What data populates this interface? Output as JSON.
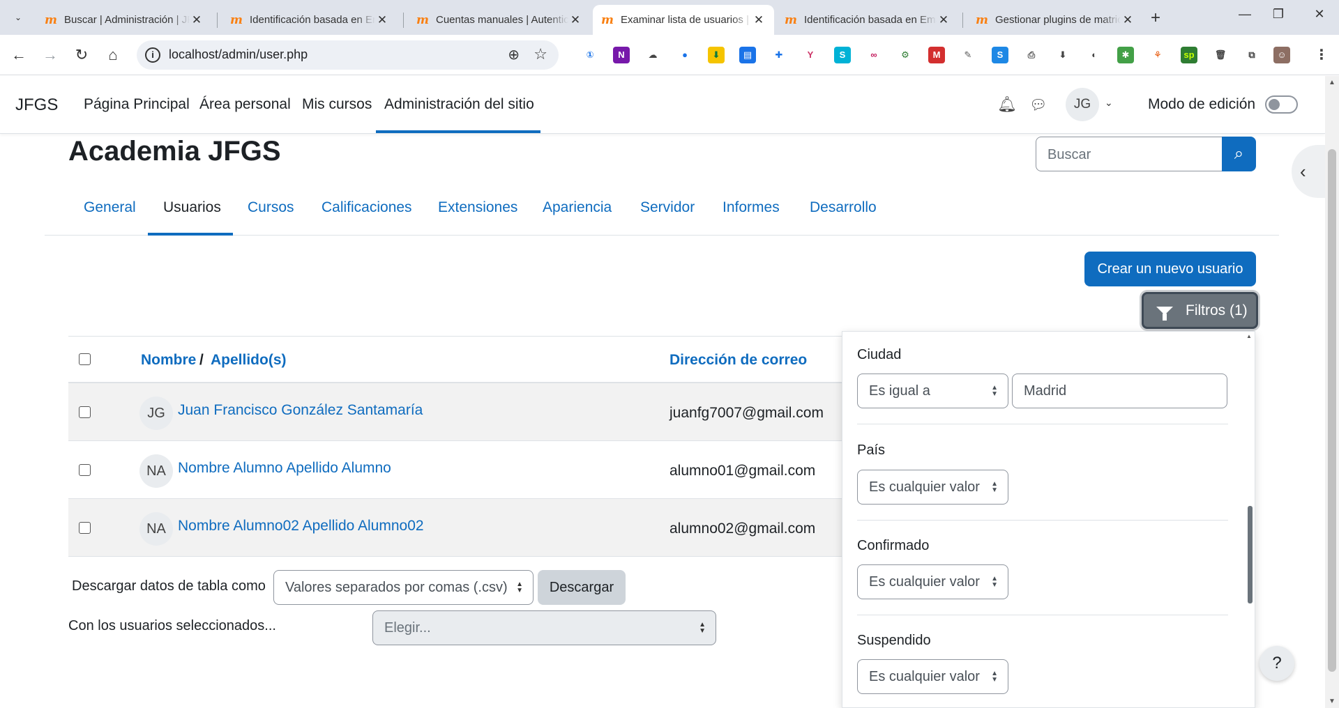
{
  "browser": {
    "tabs": [
      {
        "title": "Buscar | Administración | JFGS",
        "active": false
      },
      {
        "title": "Identificación basada en Email",
        "active": false
      },
      {
        "title": "Cuentas manuales | Autenticación",
        "active": false
      },
      {
        "title": "Examinar lista de usuarios | Academia JFGS",
        "active": true
      },
      {
        "title": "Identificación basada en Email",
        "active": false
      },
      {
        "title": "Gestionar plugins de matriculación",
        "active": false
      }
    ],
    "tab_close": "✕",
    "new_tab": "+",
    "url": "localhost/admin/user.php",
    "extensions": [
      {
        "name": "password-manager-icon",
        "glyph": "①",
        "color": "#ffffff",
        "fg": "#1a73e8"
      },
      {
        "name": "onenote-icon",
        "glyph": "N",
        "color": "#7719aa",
        "fg": "#ffffff"
      },
      {
        "name": "cloud-icon",
        "glyph": "☁",
        "color": "#ffffff",
        "fg": "#444444"
      },
      {
        "name": "blue-dot-icon",
        "glyph": "●",
        "color": "#ffffff",
        "fg": "#1a73e8"
      },
      {
        "name": "download-green-icon",
        "glyph": "⬇",
        "color": "#f5c400",
        "fg": "#0b7a3e"
      },
      {
        "name": "save-icon",
        "glyph": "▤",
        "color": "#1a73e8",
        "fg": "#ffffff"
      },
      {
        "name": "doc-plus-icon",
        "glyph": "✚",
        "color": "#ffffff",
        "fg": "#1a73e8"
      },
      {
        "name": "leaf-icon",
        "glyph": "Y",
        "color": "#ffffff",
        "fg": "#cc3366"
      },
      {
        "name": "s-icon",
        "glyph": "S",
        "color": "#00b2d6",
        "fg": "#ffffff"
      },
      {
        "name": "link-icon",
        "glyph": "∞",
        "color": "#ffffff",
        "fg": "#c2185b"
      },
      {
        "name": "bike-icon",
        "glyph": "⚙",
        "color": "#ffffff",
        "fg": "#2e7d32"
      },
      {
        "name": "m-icon",
        "glyph": "M",
        "color": "#d32f2f",
        "fg": "#ffffff"
      },
      {
        "name": "note-icon",
        "glyph": "✎",
        "color": "#ffffff",
        "fg": "#555555"
      },
      {
        "name": "s-blue-icon",
        "glyph": "S",
        "color": "#1e88e5",
        "fg": "#ffffff"
      },
      {
        "name": "pdf-icon",
        "glyph": "⎙",
        "color": "#ffffff",
        "fg": "#555555"
      },
      {
        "name": "arrow-down-icon",
        "glyph": "⬇",
        "color": "#ffffff",
        "fg": "#444444"
      },
      {
        "name": "dark-mode-icon",
        "glyph": "◐",
        "color": "#ffffff",
        "fg": "#444444"
      },
      {
        "name": "puzzle-green-icon",
        "glyph": "✱",
        "color": "#43a047",
        "fg": "#ffffff"
      },
      {
        "name": "tree-icon",
        "glyph": "⚘",
        "color": "#ffffff",
        "fg": "#e65100"
      },
      {
        "name": "sp-icon",
        "glyph": "sp",
        "color": "#2e7d32",
        "fg": "#c6ff00"
      },
      {
        "name": "trash-icon",
        "glyph": "🗑",
        "color": "#ffffff",
        "fg": "#444444"
      },
      {
        "name": "extensions-puzzle-icon",
        "glyph": "⧉",
        "color": "#ffffff",
        "fg": "#444444"
      },
      {
        "name": "profile-icon",
        "glyph": "☺",
        "color": "#8d6e63",
        "fg": "#ffffff"
      },
      {
        "name": "menu-kebab-icon",
        "glyph": "⋮",
        "color": "#ffffff",
        "fg": "#444444"
      }
    ]
  },
  "nav": {
    "brand": "JFGS",
    "primary": [
      "Página Principal",
      "Área personal",
      "Mis cursos",
      "Administración del sitio"
    ],
    "user_initials": "JG",
    "edit_mode_label": "Modo de edición"
  },
  "page": {
    "title": "Academia JFGS",
    "search_placeholder": "Buscar",
    "secondary_tabs": [
      "General",
      "Usuarios",
      "Cursos",
      "Calificaciones",
      "Extensiones",
      "Apariencia",
      "Servidor",
      "Informes",
      "Desarrollo"
    ],
    "create_user_button": "Crear un nuevo usuario",
    "filters_button": "Filtros (1)"
  },
  "table": {
    "headers": {
      "first_name": "Nombre",
      "separator": "/",
      "last_name": "Apellido(s)",
      "email": "Dirección de correo"
    },
    "rows": [
      {
        "initials": "JG",
        "name": "Juan Francisco González Santamaría",
        "email": "juanfg7007@gmail.com"
      },
      {
        "initials": "NA",
        "name": "Nombre Alumno Apellido Alumno",
        "email": "alumno01@gmail.com"
      },
      {
        "initials": "NA",
        "name": "Nombre Alumno02 Apellido Alumno02",
        "email": "alumno02@gmail.com"
      }
    ]
  },
  "download": {
    "label": "Descargar datos de tabla como",
    "format": "Valores separados por comas (.csv)",
    "button": "Descargar"
  },
  "bulk": {
    "label": "Con los usuarios seleccionados...",
    "select": "Elegir..."
  },
  "filters": {
    "city": {
      "label": "Ciudad",
      "operator": "Es igual a",
      "value": "Madrid"
    },
    "country": {
      "label": "País",
      "value": "Es cualquier valor"
    },
    "confirmed": {
      "label": "Confirmado",
      "value": "Es cualquier valor"
    },
    "suspended": {
      "label": "Suspendido",
      "value": "Es cualquier valor"
    }
  },
  "help_button": "?",
  "colors": {
    "primary": "#0f6cbf",
    "moodle_orange": "#f98012",
    "secondary": "#6a737b"
  }
}
